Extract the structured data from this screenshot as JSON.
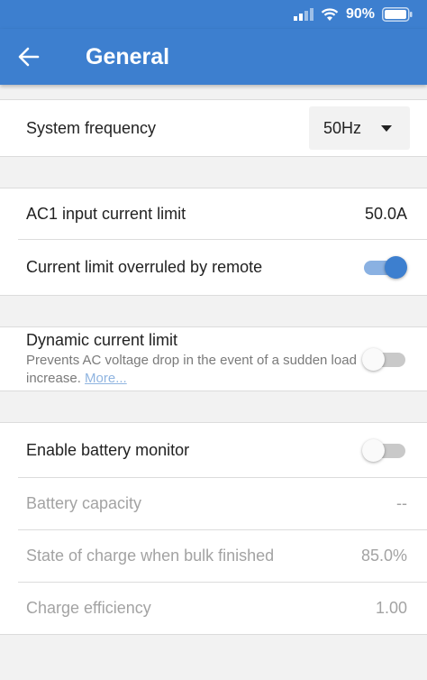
{
  "status_bar": {
    "battery_percent": "90%",
    "signal_icon": "signal-bars-icon",
    "wifi_icon": "wifi-icon",
    "battery_icon": "battery-icon"
  },
  "header": {
    "back_icon": "arrow-left-icon",
    "title": "General"
  },
  "settings": {
    "system_frequency": {
      "label": "System frequency",
      "value": "50Hz"
    },
    "ac1_limit": {
      "label": "AC1 input current limit",
      "value": "50.0A"
    },
    "overruled": {
      "label": "Current limit overruled by remote",
      "enabled": true
    },
    "dynamic": {
      "label": "Dynamic current limit",
      "description": "Prevents AC voltage drop in the event of a sudden load increase.",
      "more_link": "More...",
      "enabled": false
    },
    "battery_monitor": {
      "label": "Enable battery monitor",
      "enabled": false
    },
    "battery_capacity": {
      "label": "Battery capacity",
      "value": "--"
    },
    "soc_bulk": {
      "label": "State of charge when bulk finished",
      "value": "85.0%"
    },
    "charge_efficiency": {
      "label": "Charge efficiency",
      "value": "1.00"
    }
  },
  "colors": {
    "primary": "#3d7fcf",
    "disabled_text": "#a3a3a3",
    "link": "#8fb4e0"
  }
}
